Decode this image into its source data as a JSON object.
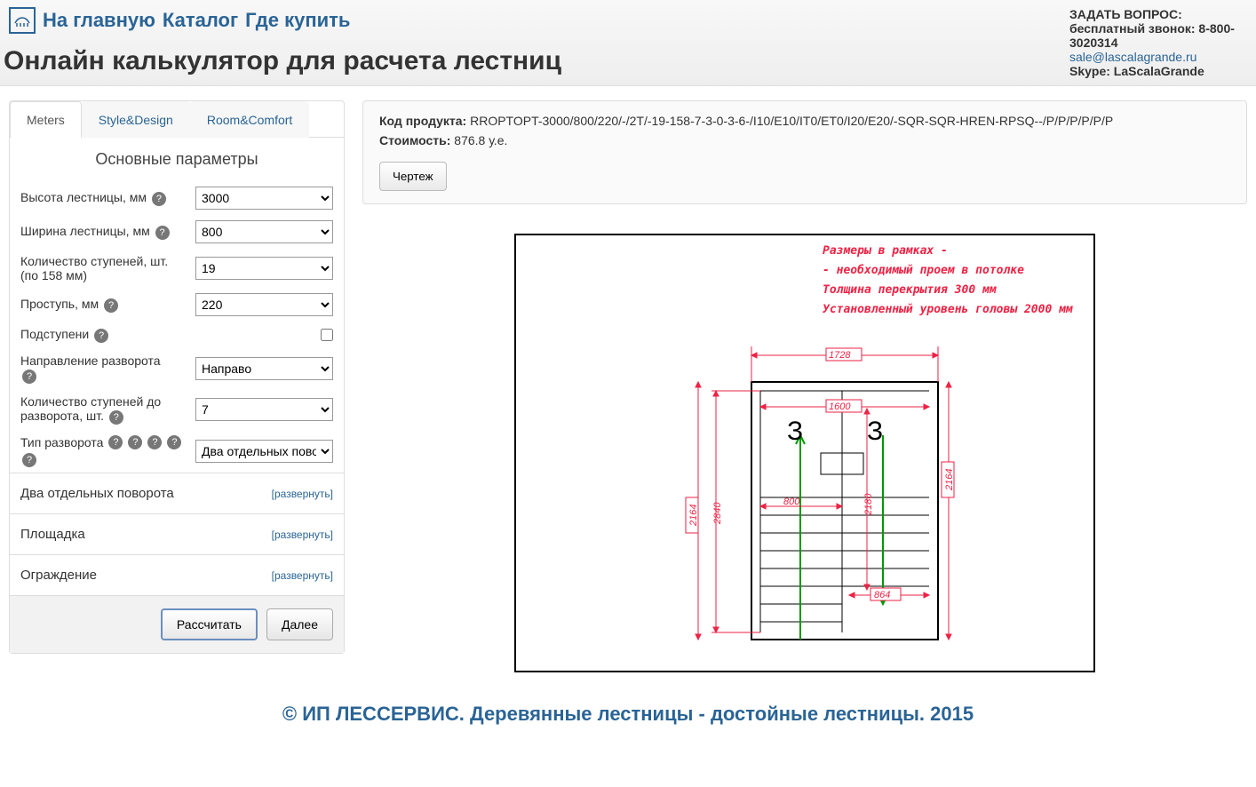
{
  "nav": {
    "home": "На главную",
    "catalog": "Каталог",
    "where": "Где купить"
  },
  "page_title": "Онлайн калькулятор для расчета лестниц",
  "contact": {
    "ask": "ЗАДАТЬ ВОПРОС:",
    "call": "бесплатный звонок: 8-800-3020314",
    "email": "sale@lascalagrande.ru",
    "skype": "Skype: LaScalaGrande"
  },
  "tabs": {
    "meters": "Meters",
    "style": "Style&Design",
    "room": "Room&Comfort"
  },
  "panel_title": "Основные параметры",
  "labels": {
    "height": "Высота лестницы, мм",
    "width": "Ширина лестницы, мм",
    "steps": "Количество ступеней, шт. (по 158 мм)",
    "tread": "Проступь, мм",
    "risers": "Подступени",
    "direction": "Направление разворота",
    "steps_before": "Количество ступеней до разворота, шт.",
    "turn_type": "Тип разворота"
  },
  "values": {
    "height": "3000",
    "width": "800",
    "steps": "19",
    "tread": "220",
    "direction": "Направо",
    "steps_before": "7",
    "turn_type": "Два отдельных пово"
  },
  "help_icon": "?",
  "accordion": {
    "a1": "Два отдельных поворота",
    "a2": "Площадка",
    "a3": "Ограждение",
    "expand": "[развернуть]"
  },
  "buttons": {
    "calc": "Рассчитать",
    "next": "Далее",
    "draw": "Чертеж"
  },
  "product": {
    "code_lbl": "Код продукта:",
    "code": "RROPTOPT-3000/800/220/-/2T/-19-158-7-3-0-3-6-/I10/E10/IT0/ET0/I20/E20/-SQR-SQR-HREN-RPSQ--/P/P/P/P/P/P",
    "cost_lbl": "Стоимость:",
    "cost": "876.8 у.е."
  },
  "drawing_notes": {
    "l1": "Размеры в рамках -",
    "l2": "- необходимый проем в потолке",
    "l3": "Толщина перекрытия 300 мм",
    "l4": "Установленный уровень головы 2000 мм"
  },
  "drawing_dims": {
    "d1": "1728",
    "d2": "1600",
    "d3": "800",
    "d4": "2840",
    "d5": "2164",
    "d6": "864",
    "d7": "2164",
    "d8": "2180"
  },
  "footer": "© ИП ЛЕССЕРВИС. Деревянные лестницы - достойные лестницы. 2015"
}
